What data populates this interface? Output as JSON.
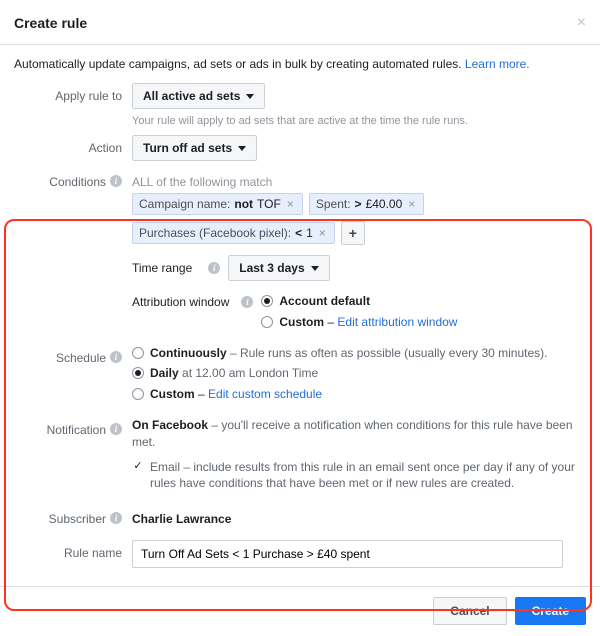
{
  "header": {
    "title": "Create rule"
  },
  "subhead": {
    "text": "Automatically update campaigns, ad sets or ads in bulk by creating automated rules. ",
    "link": "Learn more."
  },
  "applyRule": {
    "label": "Apply rule to",
    "value": "All active ad sets",
    "help": "Your rule will apply to ad sets that are active at the time the rule runs."
  },
  "action": {
    "label": "Action",
    "value": "Turn off ad sets"
  },
  "conditions": {
    "label": "Conditions",
    "matchText": "ALL of the following match",
    "chips": [
      {
        "key": "Campaign name:",
        "op": "not",
        "val": "TOF"
      },
      {
        "key": "Spent:",
        "op": ">",
        "val": "£40.00"
      },
      {
        "key": "Purchases (Facebook pixel):",
        "op": "<",
        "val": "1"
      }
    ],
    "timeRange": {
      "label": "Time range",
      "value": "Last 3 days"
    },
    "attribution": {
      "label": "Attribution window",
      "options": {
        "default": "Account default",
        "custom": "Custom",
        "customLink": "Edit attribution window"
      }
    }
  },
  "schedule": {
    "label": "Schedule",
    "continuously": {
      "title": "Continuously",
      "desc": " – Rule runs as often as possible (usually every 30 minutes)."
    },
    "daily": {
      "title": "Daily",
      "desc": " at 12.00 am London Time"
    },
    "custom": {
      "title": "Custom",
      "link": "Edit custom schedule"
    }
  },
  "notification": {
    "label": "Notification",
    "onFacebook": {
      "title": "On Facebook",
      "desc": " – you'll receive a notification when conditions for this rule have been met."
    },
    "email": {
      "title": "Email",
      "desc": " – include results from this rule in an email sent once per day if any of your rules have conditions that have been met or if new rules are created."
    }
  },
  "subscriber": {
    "label": "Subscriber",
    "name": "Charlie Lawrance"
  },
  "ruleName": {
    "label": "Rule name",
    "value": "Turn Off Ad Sets < 1 Purchase > £40 spent"
  },
  "footer": {
    "cancel": "Cancel",
    "create": "Create"
  }
}
